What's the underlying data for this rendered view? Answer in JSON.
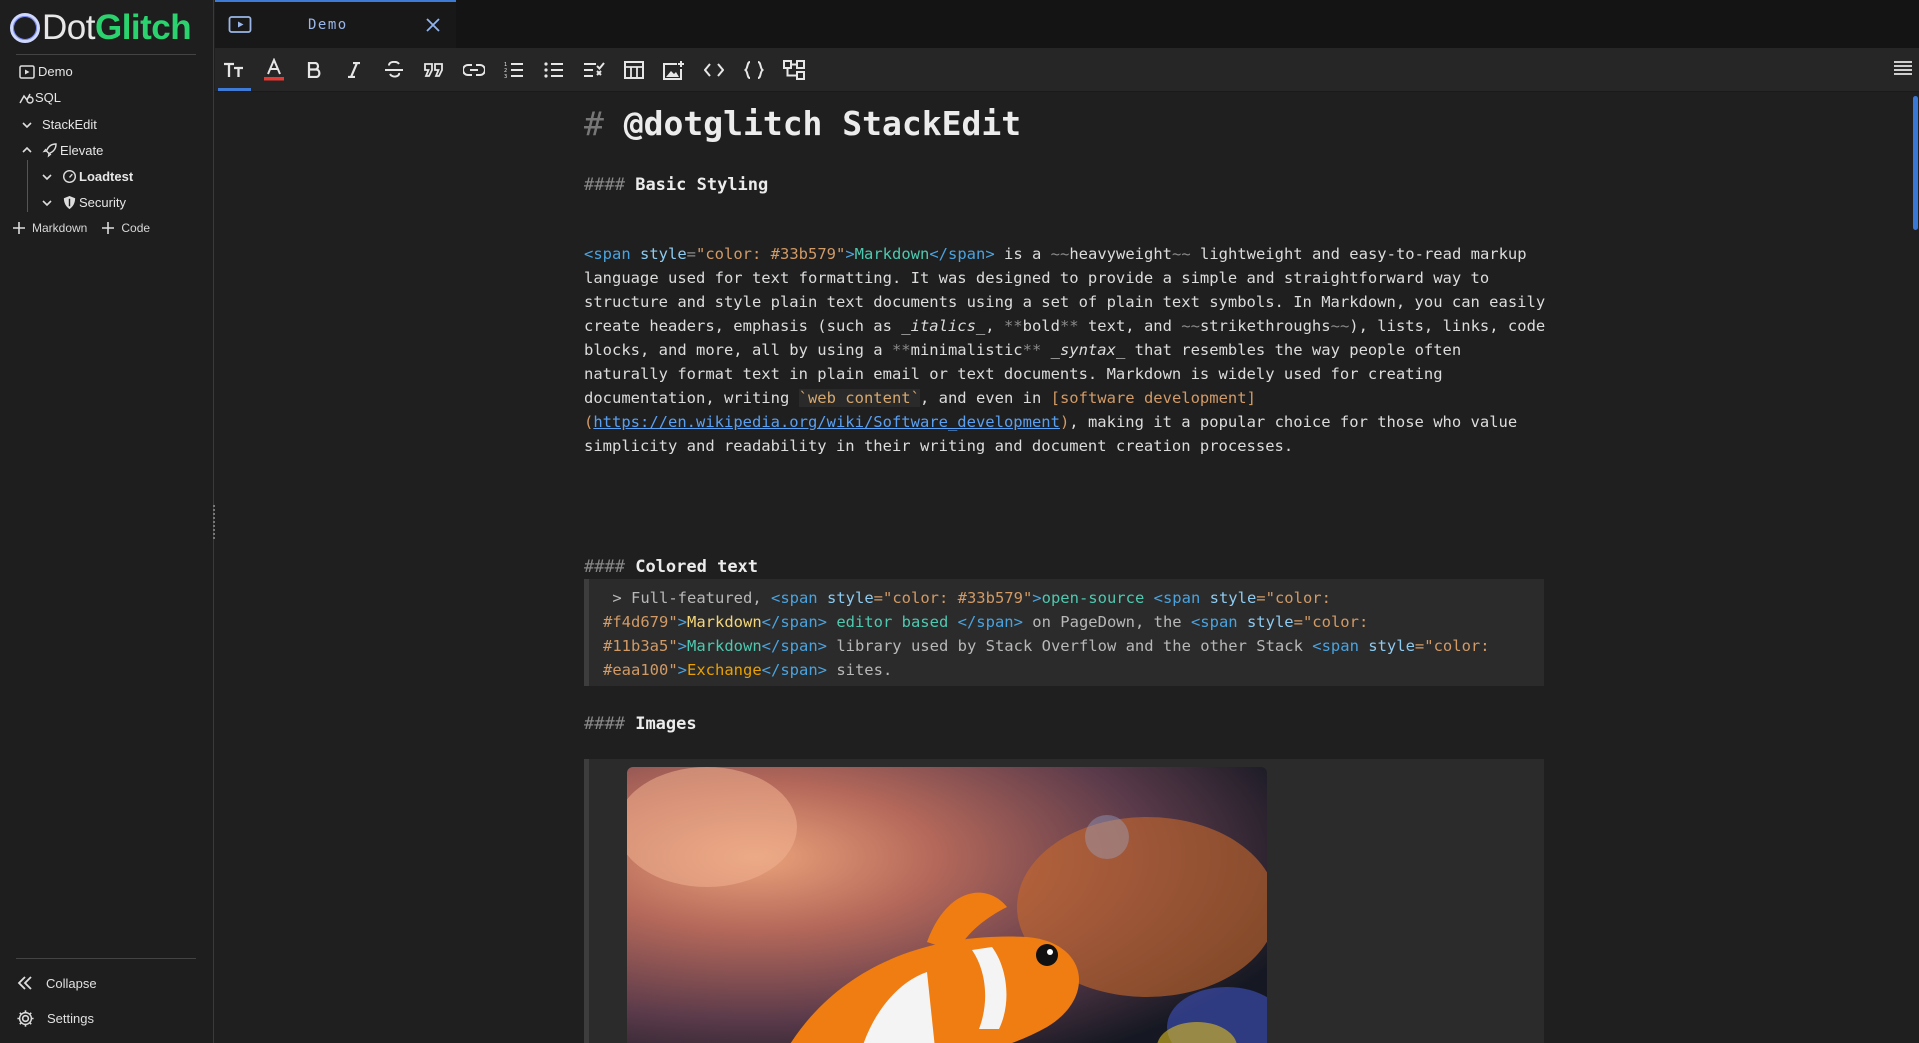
{
  "logo": {
    "dot": "Dot",
    "glitch": "Glitch"
  },
  "sidebar": {
    "items": [
      {
        "label": "Demo",
        "icon": "preview-icon"
      },
      {
        "label": "SQL",
        "icon": "sql-icon"
      },
      {
        "label": "StackEdit",
        "icon": "chevron-down-icon"
      },
      {
        "label": "Elevate",
        "icon": "rocket-icon"
      },
      {
        "label": "Loadtest",
        "icon": "gauge-icon"
      },
      {
        "label": "Security",
        "icon": "shield-icon"
      }
    ],
    "add_markdown": "Markdown",
    "add_code": "Code",
    "collapse": "Collapse",
    "settings": "Settings"
  },
  "tab": {
    "title": "Demo"
  },
  "toolbar": {
    "buttons": [
      "text-size",
      "text-color",
      "bold",
      "italic",
      "strikethrough",
      "quote",
      "link",
      "ordered-list",
      "bullet-list",
      "checklist",
      "table",
      "image",
      "inline-code",
      "code-block",
      "diagram"
    ]
  },
  "doc": {
    "h1_hash": "#",
    "h1": "@dotglitch StackEdit",
    "h4_hash": "####",
    "h4_basic": "Basic Styling",
    "h4_colored": "Colored text",
    "h4_images": "Images",
    "p": {
      "t1": "<span",
      "t2": " style",
      "t3": "=",
      "t4": "\"color: #33b579\"",
      "t5": ">",
      "t6": "Markdown",
      "t7": "</span>",
      "t8": " is a ",
      "t9": "~~",
      "t10": "heavyweight",
      "t11": "~~",
      "t12": " lightweight and easy-to-read markup language used for text formatting. It was designed to provide a simple and straightforward way to structure and style plain text documents using a set of plain text symbols. In Markdown, you can easily create headers, emphasis (such as ",
      "t13": "_italics_",
      "t14": ", ",
      "t15": "**",
      "t16": "bold",
      "t17": "**",
      "t18": " text, and ",
      "t19": "~~",
      "t20": "strikethroughs",
      "t21": "~~",
      "t22": "), lists, links, code blocks, and more, all by using a ",
      "t23": "**",
      "t24": "minimalistic",
      "t25": "**",
      "t26": " ",
      "t27": "_syntax_",
      "t28": " that resembles the way people often naturally format text in plain email or text documents. Markdown is widely used for creating documentation, writing ",
      "t29": "`web content`",
      "t30": ", and even in ",
      "t31": "[software development](",
      "t32": "https://en.wikipedia.org/wiki/Software_development",
      "t33": ")",
      "t34": ", making it a popular choice for those who value simplicity and readability in their writing and document creation processes."
    },
    "q": {
      "a": " > Full-featured, ",
      "b": "<span",
      "c": " style",
      "d": "=\"color: #33b579\"",
      "e": ">",
      "f": "open-source ",
      "g": "<span",
      "h": " style",
      "i": "=\"color: #f4d679\"",
      "j": ">",
      "k": "Markdown",
      "l": "</span>",
      "m": " editor based ",
      "n": "</span>",
      "o": " on PageDown, the ",
      "p": "<span",
      "q": " style",
      "r": "=\"color: #11b3a5\"",
      "s": ">",
      "t": "Markdown",
      "u": "</span>",
      "v": " library used by Stack Overflow and the other Stack ",
      "w": "<span",
      "x": " style",
      "y": "=\"color: #eaa100\"",
      "z": ">",
      "aa": "Exchange",
      "ab": "</span>",
      "ac": " sites."
    }
  },
  "colors": {
    "accent": "#3d7bd6",
    "brand_green": "#2bd36e"
  }
}
